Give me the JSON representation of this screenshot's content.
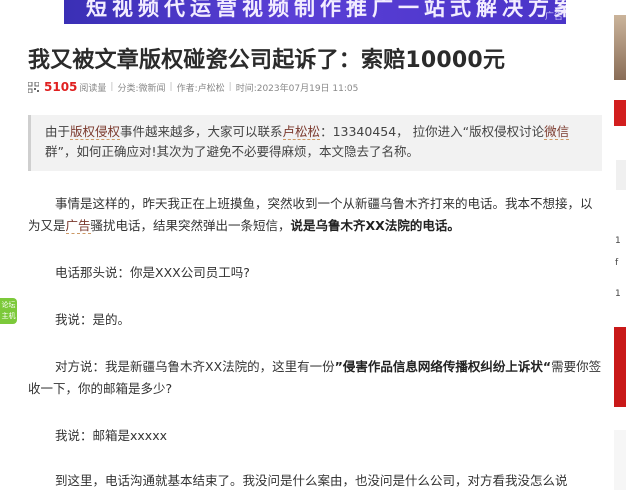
{
  "banner": {
    "text": "短视频代运营视频制作推广一站式解决方案",
    "ad_label": "广告"
  },
  "left_float": {
    "line1": "论坛",
    "line2": "主机"
  },
  "article": {
    "title": "我又被文章版权碰瓷公司起诉了：索赔10000元",
    "views": "5105",
    "views_label": "阅读量",
    "category_label": "分类:",
    "category": "微新闻",
    "author_label": "作者:",
    "author": "卢松松",
    "time_label": "时间:",
    "time": "2023年07月19日 11:05"
  },
  "notice": {
    "t1": "由于",
    "kw1": "版权侵权",
    "t2": "事件越来越多，大家可以联系",
    "kw2": "卢松松",
    "t3": "：13340454， 拉你进入“版权侵权讨论",
    "kw3": "微信",
    "t4": "群”，如何正确应对!其次为了避免不必要得麻烦，本文隐去了名称。"
  },
  "paragraphs": {
    "p1_a": "事情是这样的，昨天我正在上班摸鱼，突然收到一个从新疆乌鲁木齐打来的电话。我本不想接，以为又是",
    "p1_link": "广告",
    "p1_b": "骚扰电话，结果突然弹出一条短信，",
    "p1_bold": "说是乌鲁木齐XX法院的电话。",
    "p2": "电话那头说：你是XXX公司员工吗?",
    "p3": "我说：是的。",
    "p4_a": "对方说：我是新疆乌鲁木齐XX法院的，这里有一份",
    "p4_bold": "”侵害作品信息网络传播权纠纷上诉状“",
    "p4_b": "需要你签收一下，你的邮箱是多少?",
    "p5": "我说：邮箱是xxxxx",
    "p6": "到这里，电话沟通就基本结束了。我没问是什么案由，也没问是什么公司，对方看我没怎么说"
  },
  "right_col": {
    "glyph1": "1",
    "glyph2": "f",
    "glyph3": "1"
  }
}
